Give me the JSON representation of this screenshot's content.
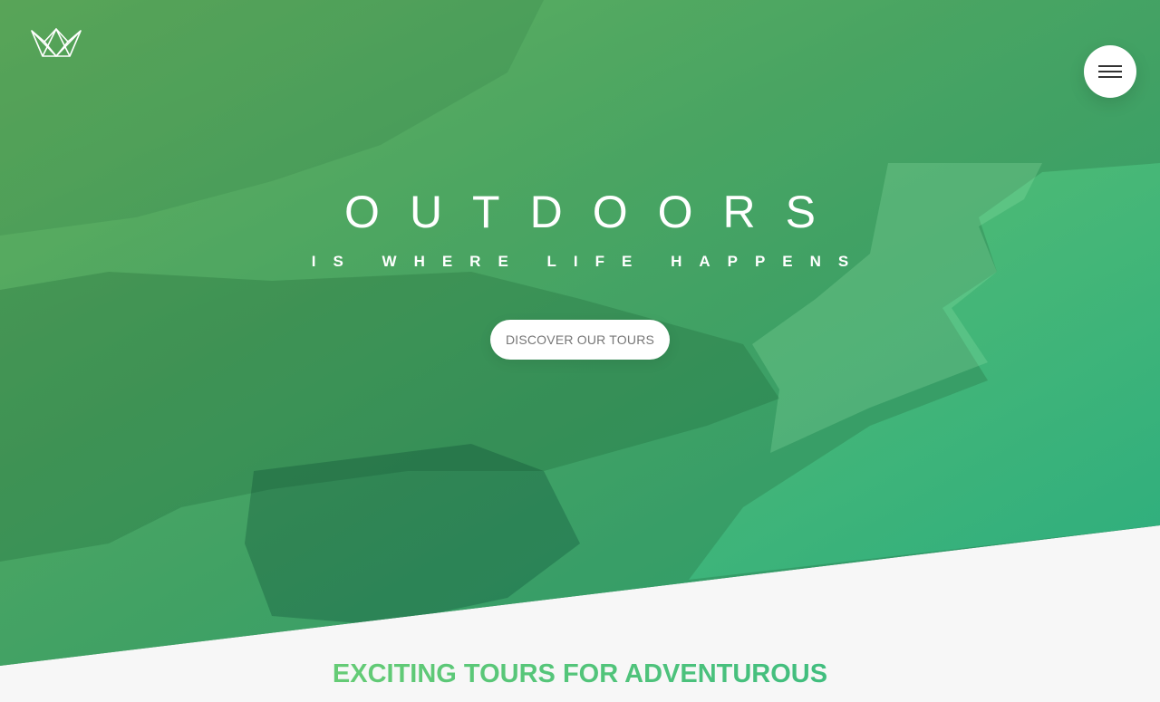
{
  "header": {
    "logo_icon": "crown-logo-icon",
    "menu_icon": "hamburger-menu-icon"
  },
  "hero": {
    "title_primary": "OUTDOORS",
    "title_secondary": "IS WHERE LIFE HAPPENS",
    "cta_label": "DISCOVER OUR TOURS"
  },
  "section": {
    "heading": "EXCITING TOURS FOR ADVENTUROUS"
  },
  "colors": {
    "gradient_start": "#7ed56f",
    "gradient_end": "#28b485",
    "background": "#f7f7f7",
    "white": "#ffffff"
  }
}
